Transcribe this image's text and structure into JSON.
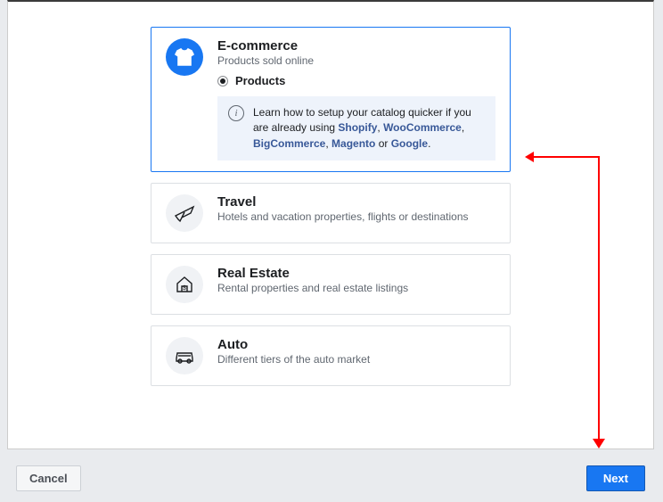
{
  "options": {
    "ecommerce": {
      "title": "E-commerce",
      "desc": "Products sold online",
      "radio_label": "Products",
      "info_pre": "Learn how to setup your catalog quicker if you are already using ",
      "l1": "Shopify",
      "c1": ", ",
      "l2": "WooCommerce",
      "c2": ", ",
      "l3": "BigCommerce",
      "c3": ", ",
      "l4": "Magento",
      "c4": " or ",
      "l5": "Google",
      "post": "."
    },
    "travel": {
      "title": "Travel",
      "desc": "Hotels and vacation properties, flights or destinations"
    },
    "real_estate": {
      "title": "Real Estate",
      "desc": "Rental properties and real estate listings"
    },
    "auto": {
      "title": "Auto",
      "desc": "Different tiers of the auto market"
    }
  },
  "footer": {
    "cancel": "Cancel",
    "next": "Next"
  }
}
